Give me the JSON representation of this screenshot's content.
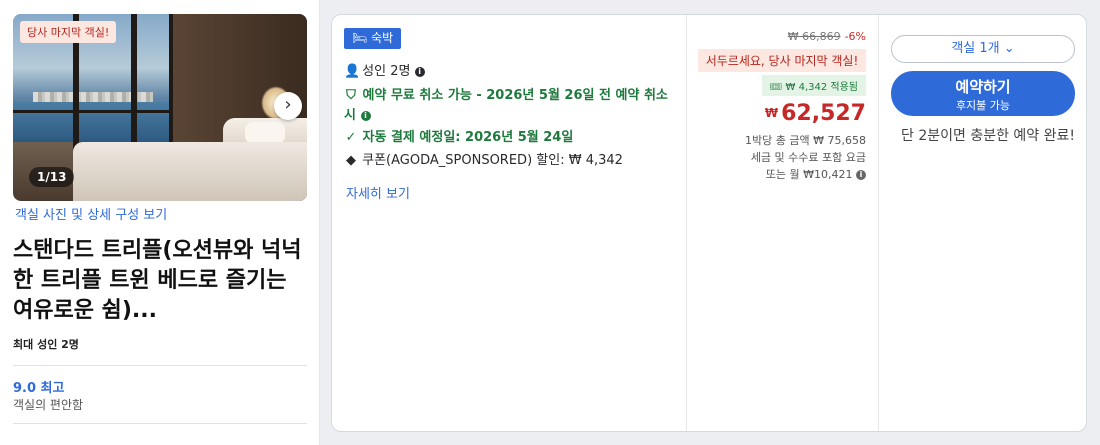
{
  "left": {
    "badge": "당사 마지막 객실!",
    "photo_counter": "1/13",
    "room_link": "객실 사진 및 상세 구성 보기",
    "room_title": "스탠다드 트리플(오션뷰와 넉넉한 트리플 트윈 베드로 즐기는 여유로운 쉼)...",
    "max_occupancy": "최대 성인 2명",
    "score": "9.0 최고",
    "score_label": "객실의 편안함"
  },
  "benefits": {
    "tag": "숙박",
    "guests": "성인 2명",
    "free_cancel": "예약 무료 취소 가능 - 2026년 5월 26일 전 예약 취소 시",
    "auto_pay": "자동 결제 예정일: 2026년 5월 24일",
    "coupon": "쿠폰(AGODA_SPONSORED) 할인: ₩ 4,342",
    "details_link": "자세히 보기"
  },
  "pricing": {
    "original_price": "₩ 66,869",
    "discount": "-6%",
    "urgency": "서두르세요, 당사 마지막 객실!",
    "applied": "₩ 4,342 적용됨",
    "currency": "₩",
    "price": "62,527",
    "total_line": "1박당 총 금액 ₩ 75,658",
    "tax_line": "세금 및 수수료 포함 요금",
    "monthly_line": "또는 월 ₩10,421"
  },
  "booking": {
    "rooms_select": "객실 1개",
    "book_label": "예약하기",
    "book_sub": "후지불 가능",
    "note": "단 2분이면 충분한 예약 완료!"
  },
  "colors": {
    "brand_blue": "#2f6ad9",
    "price_red": "#c62828",
    "success_green": "#1e7a3c"
  }
}
